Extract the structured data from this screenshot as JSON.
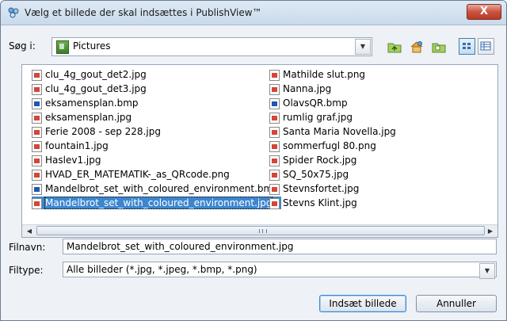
{
  "window": {
    "title": "Vælg et billede der skal indsættes i PublishView™",
    "close_label": "X"
  },
  "look_in": {
    "label": "Søg i:",
    "value": "Pictures"
  },
  "toolbar": {
    "icons": [
      "up-folder-icon",
      "home-icon",
      "new-folder-icon",
      "list-view-icon",
      "details-view-icon"
    ]
  },
  "files": {
    "column1": [
      {
        "name": "clu_4g_gout_det2.jpg",
        "type": "jpg"
      },
      {
        "name": "clu_4g_gout_det3.jpg",
        "type": "jpg"
      },
      {
        "name": "eksamensplan.bmp",
        "type": "bmp"
      },
      {
        "name": "eksamensplan.jpg",
        "type": "jpg"
      },
      {
        "name": "Ferie 2008 - sep 228.jpg",
        "type": "jpg"
      },
      {
        "name": "fountain1.jpg",
        "type": "jpg"
      },
      {
        "name": "Haslev1.jpg",
        "type": "jpg"
      },
      {
        "name": "HVAD_ER_MATEMATIK-_as_QRcode.png",
        "type": "png"
      },
      {
        "name": "Mandelbrot_set_with_coloured_environment.bmp",
        "type": "bmp"
      },
      {
        "name": "Mandelbrot_set_with_coloured_environment.jpg",
        "type": "jpg",
        "selected": true
      }
    ],
    "column2": [
      {
        "name": "Mathilde slut.png",
        "type": "png"
      },
      {
        "name": "Nanna.jpg",
        "type": "jpg"
      },
      {
        "name": "OlavsQR.bmp",
        "type": "bmp"
      },
      {
        "name": "rumlig graf.jpg",
        "type": "jpg"
      },
      {
        "name": "Santa Maria Novella.jpg",
        "type": "jpg"
      },
      {
        "name": "sommerfugl 80.png",
        "type": "png"
      },
      {
        "name": "Spider Rock.jpg",
        "type": "jpg"
      },
      {
        "name": "SQ_50x75.jpg",
        "type": "jpg"
      },
      {
        "name": "Stevnsfortet.jpg",
        "type": "jpg"
      },
      {
        "name": "Stevns Klint.jpg",
        "type": "jpg"
      }
    ]
  },
  "filename": {
    "label": "Filnavn:",
    "value": "Mandelbrot_set_with_coloured_environment.jpg"
  },
  "filetype": {
    "label": "Filtype:",
    "value": "Alle billeder (*.jpg, *.jpeg, *.bmp, *.png)"
  },
  "buttons": {
    "insert_label": "Indsæt billede",
    "cancel_label": "Annuller"
  },
  "colors": {
    "selection": "#3d86cf",
    "jpg_icon": "#d4453a",
    "bmp_icon": "#1e56b0"
  }
}
